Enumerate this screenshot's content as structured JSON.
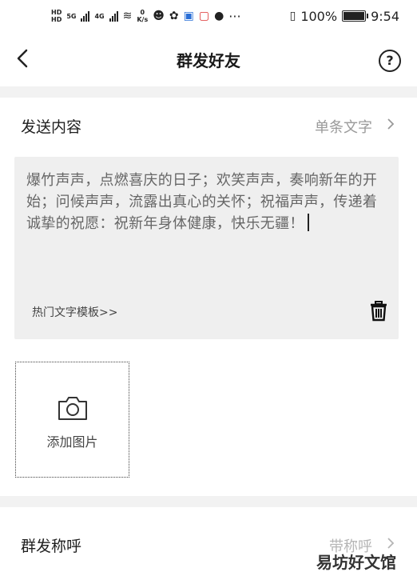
{
  "status_bar": {
    "net_speed_value": "0",
    "net_speed_unit": "K/s",
    "sim1_label": "5G",
    "sim2_label": "4G",
    "battery_percent": "100%",
    "battery_level": 1.0,
    "time": "9:54",
    "more": "···"
  },
  "nav": {
    "back_label": "<",
    "title": "群发好友",
    "help_label": "?"
  },
  "send_content": {
    "label": "发送内容",
    "value": "单条文字"
  },
  "message": {
    "text": "爆竹声声，点燃喜庆的日子；欢笑声声，奏响新年的开始；问候声声，流露出真心的关怀；祝福声声，传递着诚挚的祝愿：祝新年身体健康，快乐无疆！",
    "template_link": "热门文字模板>>"
  },
  "add_image": {
    "label": "添加图片"
  },
  "greeting": {
    "label": "群发称呼",
    "value": "带称呼"
  },
  "watermark": "易坊好文馆"
}
